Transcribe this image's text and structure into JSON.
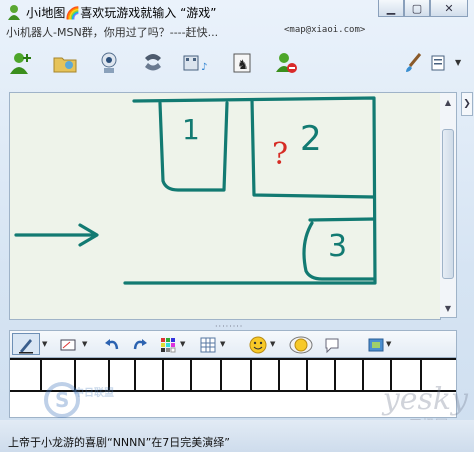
{
  "window": {
    "title": "小i地图🌈喜欢玩游戏就输入 “游戏”",
    "subtitle": "小i机器人-MSN群，你用过了吗？----赶快...",
    "email": "<map@xiaoi.com>",
    "buttons": [
      "minimize",
      "maximize",
      "close"
    ]
  },
  "toolbar": {
    "icons": [
      "add-contact-icon",
      "share-folder-icon",
      "webcam-icon",
      "phone-icon",
      "video-icon",
      "games-icon",
      "block-icon",
      "brush-icon",
      "menu-icon"
    ]
  },
  "canvas": {
    "labels": [
      "1",
      "2",
      "?",
      "3"
    ],
    "ink_color": "#127a72",
    "question_color": "#d62b24"
  },
  "toolbar2": {
    "icons": [
      "pen-icon",
      "eraser-icon",
      "undo-icon",
      "redo-icon",
      "color-grid-icon",
      "grid-icon",
      "emoticon-icon",
      "wink-icon",
      "nudge-icon",
      "bg-icon"
    ]
  },
  "status": {
    "text": "上帝于小龙游的喜剧“NNNN”在7日完美演绎”"
  },
  "watermarks": {
    "main": "yesky",
    "sub": "天极网",
    "left": "中日联盟"
  }
}
